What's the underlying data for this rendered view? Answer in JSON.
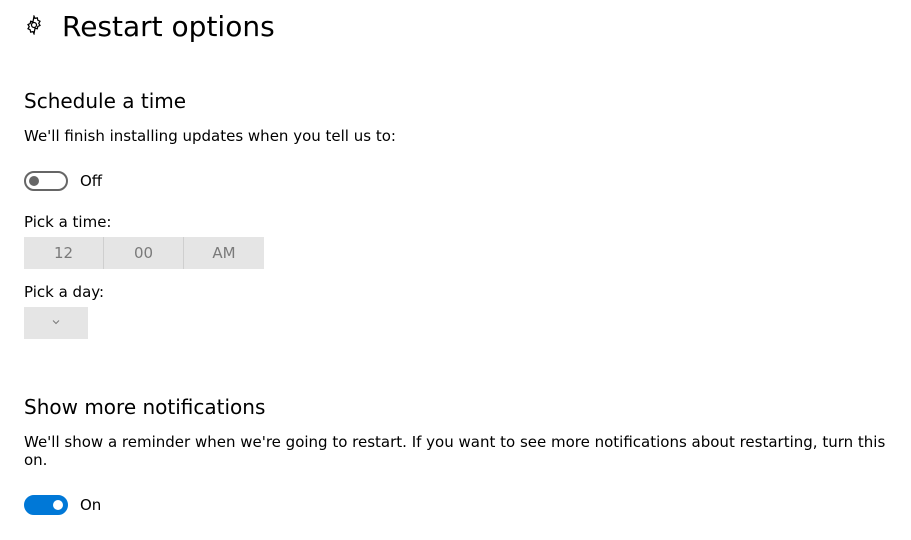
{
  "header": {
    "title": "Restart options"
  },
  "schedule": {
    "heading": "Schedule a time",
    "description": "We'll finish installing updates when you tell us to:",
    "toggle_state": "Off",
    "pick_time_label": "Pick a time:",
    "hour": "12",
    "minute": "00",
    "ampm": "AM",
    "pick_day_label": "Pick a day:",
    "day_value": ""
  },
  "notifications": {
    "heading": "Show more notifications",
    "description": "We'll show a reminder when we're going to restart. If you want to see more notifications about restarting, turn this on.",
    "toggle_state": "On"
  }
}
